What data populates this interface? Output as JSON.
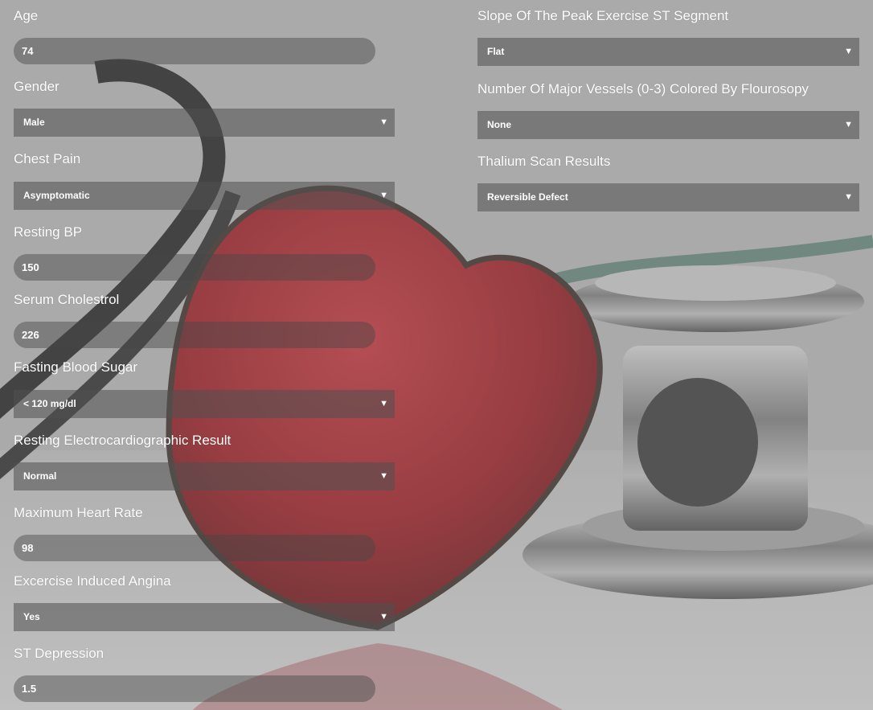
{
  "form": {
    "age": {
      "label": "Age",
      "value": "74"
    },
    "gender": {
      "label": "Gender",
      "value": "Male"
    },
    "chest_pain": {
      "label": "Chest Pain",
      "value": "Asymptomatic"
    },
    "resting_bp": {
      "label": "Resting BP",
      "value": "150"
    },
    "serum_cholesterol": {
      "label": "Serum Cholestrol",
      "value": "226"
    },
    "fasting_blood_sugar": {
      "label": "Fasting Blood Sugar",
      "value": "< 120 mg/dl"
    },
    "resting_ecg": {
      "label": "Resting Electrocardiographic Result",
      "value": "Normal"
    },
    "max_heart_rate": {
      "label": "Maximum Heart Rate",
      "value": "98"
    },
    "exercise_angina": {
      "label": "Excercise Induced Angina",
      "value": "Yes"
    },
    "st_depression": {
      "label": "ST Depression",
      "value": "1.5"
    },
    "slope": {
      "label": "Slope Of The Peak Exercise ST Segment",
      "value": "Flat"
    },
    "major_vessels": {
      "label": "Number Of Major Vessels (0-3) Colored By Flourosopy",
      "value": "None"
    },
    "thalium": {
      "label": "Thalium Scan Results",
      "value": "Reversible Defect"
    }
  },
  "icons": {
    "dropdown": "chevron-down-icon"
  },
  "colors": {
    "text": "#ffffff",
    "field_bg": "#5a5a5a",
    "heart": "#b0141c"
  }
}
